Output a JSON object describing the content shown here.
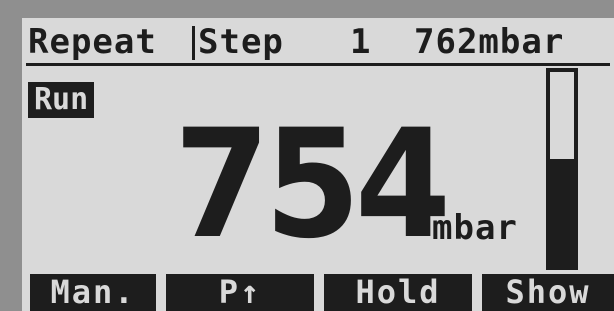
{
  "header": {
    "mode": "Repeat",
    "step_label": "Step",
    "step_number": "1",
    "setpoint": "762mbar"
  },
  "status": {
    "label": "Run"
  },
  "reading": {
    "value": "754",
    "unit": "mbar"
  },
  "gauge": {
    "level_fraction": 0.55
  },
  "softkeys": {
    "manual": "Man.",
    "pressure_up": "P↑",
    "hold": "Hold",
    "show": "Show"
  },
  "colors": {
    "lcd_background": "#d9d9d9",
    "lcd_pixel": "#1d1d1d",
    "bezel": "#8f8f8f"
  }
}
